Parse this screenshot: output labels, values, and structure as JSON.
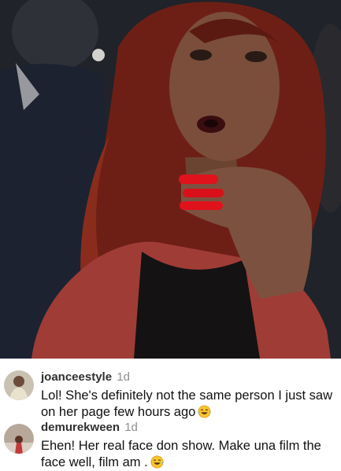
{
  "post": {
    "image_alt": "",
    "colors": {
      "hair": "#7a2418",
      "nails": "#e0121c",
      "jacket": "#a8403a",
      "background": "#1f2228"
    }
  },
  "comments": [
    {
      "username": "joanceestyle",
      "time": "1d",
      "text": "Lol! She's definitely not the same person I just saw on her page few hours ago",
      "emoji": "laughing-tears-icon"
    },
    {
      "username": "demurekween",
      "time": "1d",
      "text": "Ehen! Her real face don show. Make una film the face well, film am .",
      "emoji": "laughing-tears-icon"
    }
  ]
}
